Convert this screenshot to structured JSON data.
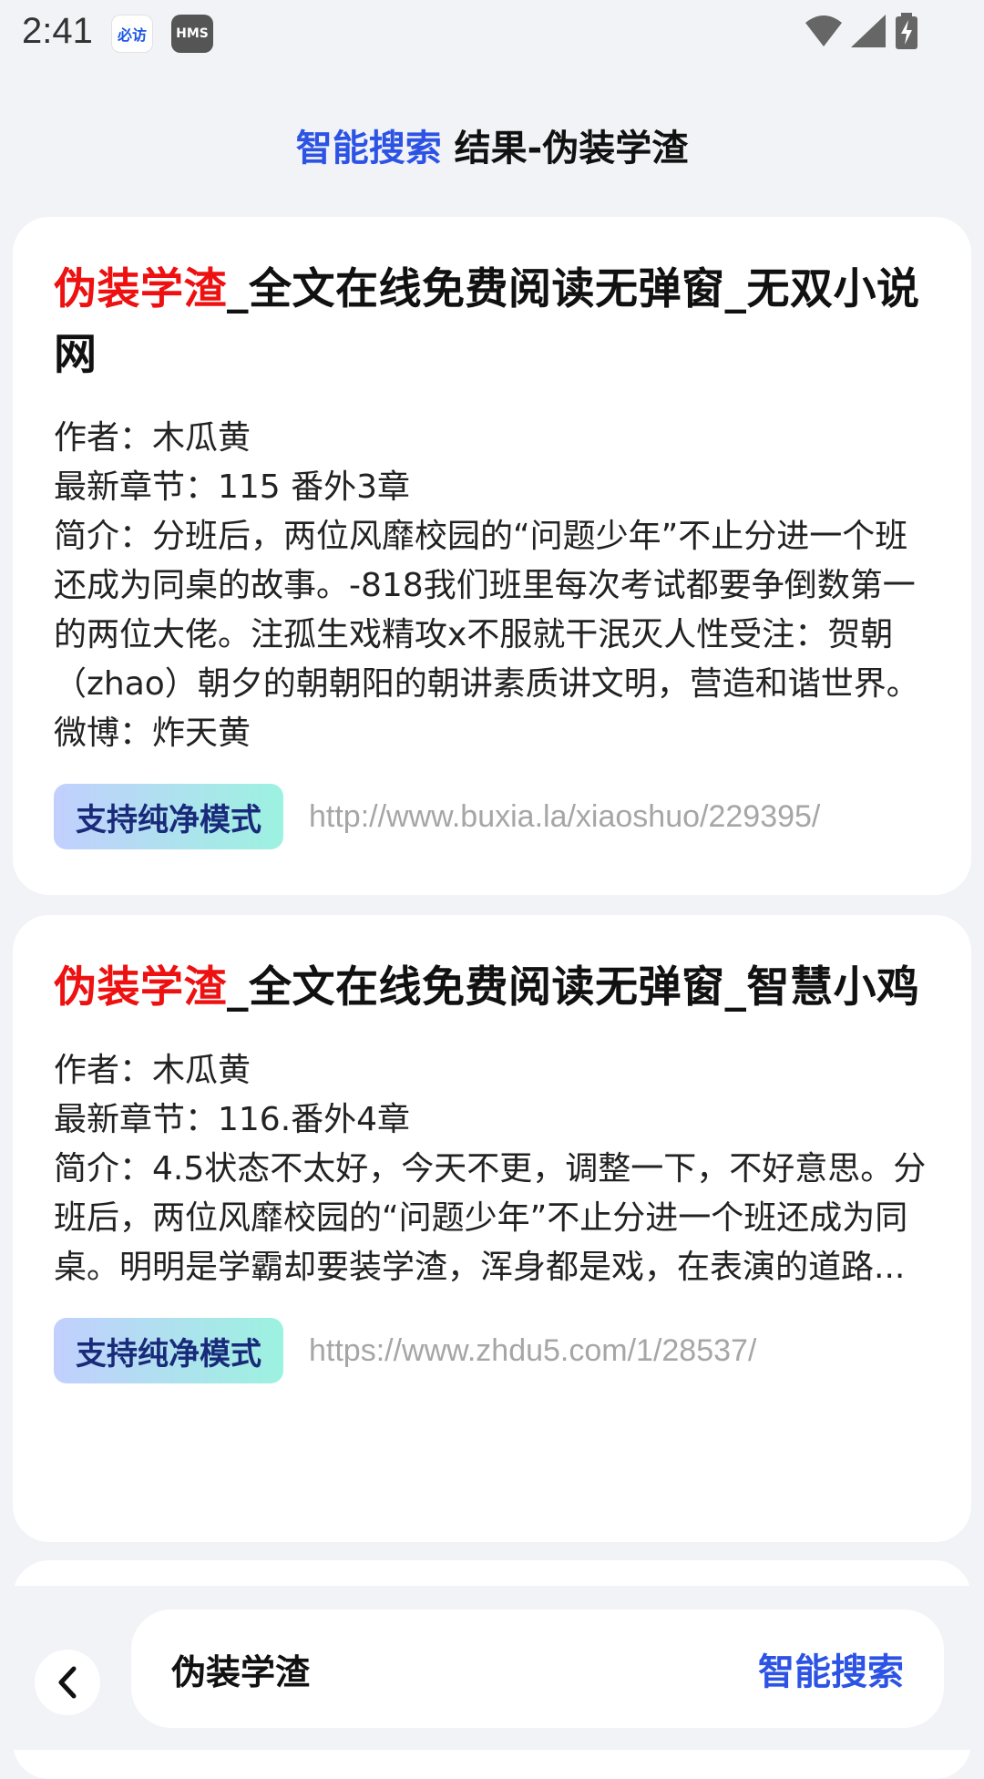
{
  "status_bar": {
    "time": "2:41",
    "app_icon_1": "必访",
    "app_icon_2": "HMS",
    "icons": [
      "wifi-icon",
      "signal-icon",
      "battery-charging-icon"
    ]
  },
  "header": {
    "accent": "智能搜索",
    "rest": " 结果-伪装学渣"
  },
  "results": [
    {
      "title_highlight": "伪装学渣",
      "title_rest": "_全文在线免费阅读无弹窗_无双小说网",
      "author": "作者：木瓜黄",
      "latest": "最新章节：115 番外3章",
      "intro": "简介：分班后，两位风靡校园的“问题少年”不止分进一个班还成为同桌的故事。-818我们班里每次考试都要争倒数第一的两位大佬。注孤生戏精攻x不服就干泯灭人性受注：贺朝（zhao）朝夕的朝朝阳的朝讲素质讲文明，营造和谐世界。微博：炸天黄",
      "tag": "支持纯净模式",
      "url": "http://www.buxia.la/xiaoshuo/229395/"
    },
    {
      "title_highlight": "伪装学渣",
      "title_rest": "_全文在线免费阅读无弹窗_智慧小鸡",
      "author": "作者：木瓜黄",
      "latest": "最新章节：116.番外4章",
      "intro": "简介：4.5状态不太好，今天不更，调整一下，不好意思。分班后，两位风靡校园的“问题少年”不止分进一个班还成为同桌。明明是学霸却要装学渣，浑身都是戏，在表演的道路...",
      "tag": "支持纯净模式",
      "url": "https://www.zhdu5.com/1/28537/"
    }
  ],
  "bottom": {
    "search_value": "伪装学渣",
    "search_button": "智能搜索",
    "back_icon": "chevron-left-icon"
  },
  "colors": {
    "accent": "#2c53e4",
    "highlight": "#ee1111",
    "url": "#a6a6a6",
    "background": "#f2f3f7"
  }
}
